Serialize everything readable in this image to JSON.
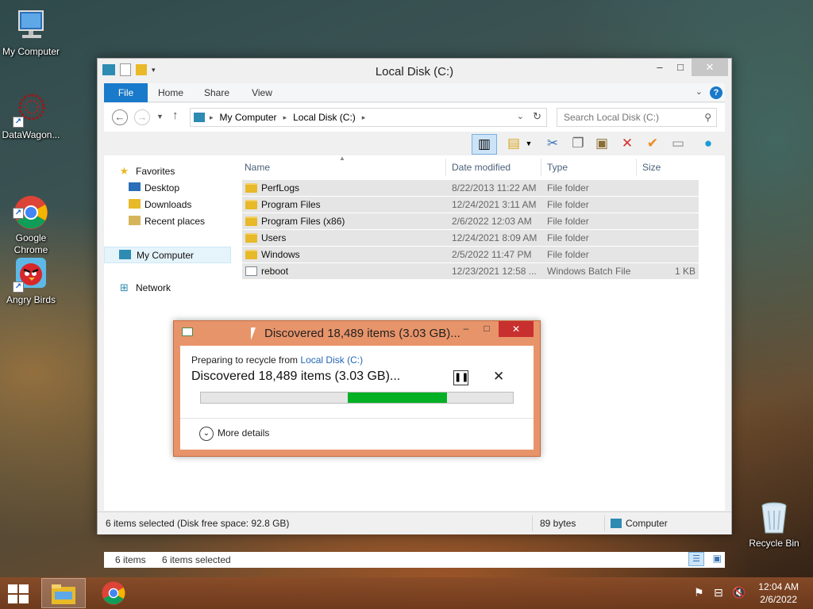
{
  "desktop": {
    "icons": [
      {
        "label": "My Computer"
      },
      {
        "label": "DataWagon..."
      },
      {
        "label": "Google\nChrome"
      },
      {
        "label": "Angry Birds"
      },
      {
        "label": "Recycle Bin"
      }
    ]
  },
  "window": {
    "title": "Local Disk (C:)",
    "caption": {
      "minimize": "–",
      "maximize": "□",
      "close": "✕"
    },
    "tabs": {
      "file": "File",
      "home": "Home",
      "share": "Share",
      "view": "View"
    },
    "address": {
      "root": "My Computer",
      "current": "Local Disk (C:)"
    },
    "search": {
      "placeholder": "Search Local Disk (C:)"
    },
    "nav_pane": {
      "favorites": "Favorites",
      "desktop": "Desktop",
      "downloads": "Downloads",
      "recent": "Recent places",
      "my_computer": "My Computer",
      "network": "Network"
    },
    "columns": {
      "name": "Name",
      "date": "Date modified",
      "type": "Type",
      "size": "Size"
    },
    "files": [
      {
        "name": "PerfLogs",
        "date": "8/22/2013 11:22 AM",
        "type": "File folder",
        "size": "",
        "kind": "folder"
      },
      {
        "name": "Program Files",
        "date": "12/24/2021 3:11 AM",
        "type": "File folder",
        "size": "",
        "kind": "folder"
      },
      {
        "name": "Program Files (x86)",
        "date": "2/6/2022 12:03 AM",
        "type": "File folder",
        "size": "",
        "kind": "folder"
      },
      {
        "name": "Users",
        "date": "12/24/2021 8:09 AM",
        "type": "File folder",
        "size": "",
        "kind": "folder"
      },
      {
        "name": "Windows",
        "date": "2/5/2022 11:47 PM",
        "type": "File folder",
        "size": "",
        "kind": "folder"
      },
      {
        "name": "reboot",
        "date": "12/23/2021 12:58 ...",
        "type": "Windows Batch File",
        "size": "1 KB",
        "kind": "batch"
      }
    ],
    "status": {
      "items": "6 items",
      "selected": "6 items selected"
    },
    "bottom": {
      "info": "6 items selected (Disk free space: 92.8 GB)",
      "size": "89 bytes",
      "location": "Computer"
    }
  },
  "dialog": {
    "title": "Discovered 18,489 items (3.03 GB)...",
    "preparing": "Preparing to recycle from",
    "source_link": "Local Disk (C:)",
    "discovered": "Discovered 18,489 items (3.03 GB)...",
    "pause_glyph": "❚❚",
    "cancel_glyph": "✕",
    "more_details": "More details",
    "progress": {
      "start": 0.47,
      "end": 0.79
    }
  },
  "taskbar": {
    "time": "12:04 AM",
    "date": "2/6/2022"
  },
  "colors": {
    "accent": "#1979ca",
    "dialog_frame": "#e8946a",
    "progress_fill": "#06b025",
    "close_red": "#c8302f"
  }
}
